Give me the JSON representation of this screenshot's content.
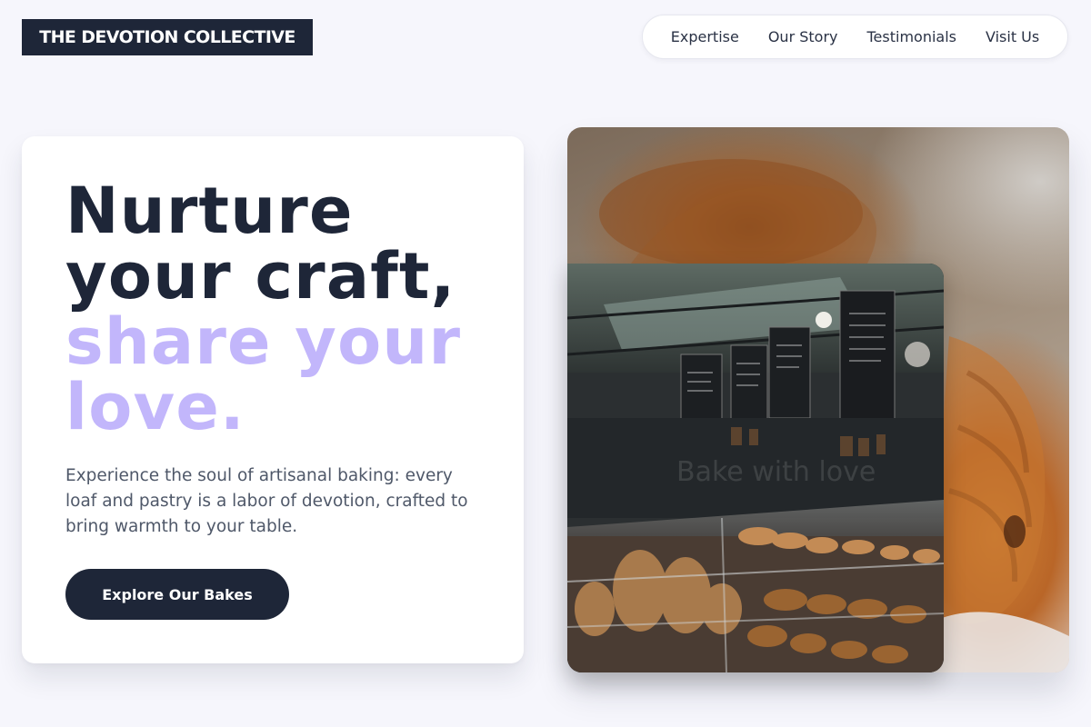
{
  "brand": {
    "name": "THE DEVOTION COLLECTIVE"
  },
  "nav": {
    "items": [
      {
        "label": "Expertise"
      },
      {
        "label": "Our Story"
      },
      {
        "label": "Testimonials"
      },
      {
        "label": "Visit Us"
      }
    ]
  },
  "hero": {
    "headline_line1": "Nurture",
    "headline_line2": "your craft,",
    "headline_line3": "share your",
    "headline_line4": "love.",
    "lead": "Experience the soul of artisanal baking: every loaf and pastry is a labor of devotion, crafted to bring warmth to your table.",
    "cta_label": "Explore Our Bakes"
  },
  "images": {
    "back_photo": "croissant-closeup",
    "front_photo": "bakery-display-case",
    "watermark": "Bake with love"
  },
  "colors": {
    "ink": "#1e2638",
    "accent": "#c2b6fb",
    "page_background": "#f6f6fc",
    "muted_text": "#4f5869"
  }
}
